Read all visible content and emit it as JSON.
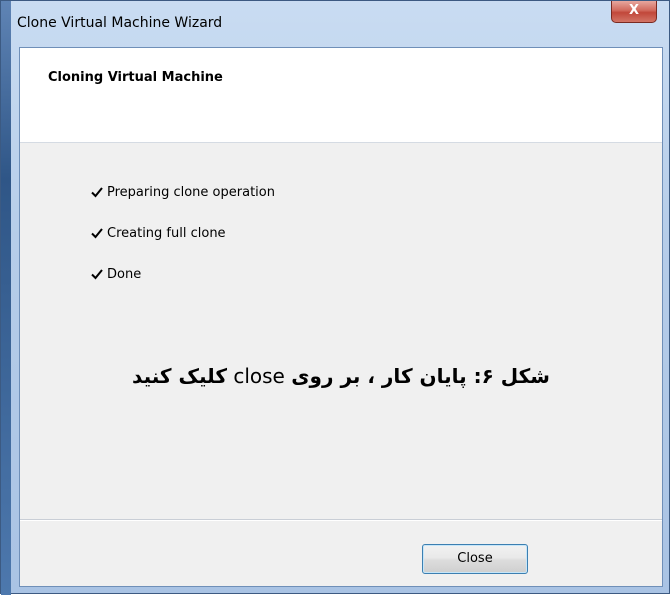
{
  "window": {
    "title": "Clone Virtual Machine Wizard",
    "close_glyph": "X",
    "close_icon": "close-icon"
  },
  "header": {
    "title": "Cloning Virtual Machine"
  },
  "steps": [
    {
      "icon": "check-icon",
      "label": "Preparing clone operation"
    },
    {
      "icon": "check-icon",
      "label": "Creating full clone"
    },
    {
      "icon": "check-icon",
      "label": "Done"
    }
  ],
  "caption": {
    "part1": "شکل ۶: پایان کار ، بر روی",
    "part2": "close",
    "part3": "کلیک کنید"
  },
  "footer": {
    "close_label": "Close"
  },
  "colors": {
    "titlebar": "#b6cde9",
    "client_bg": "#f0f0f0",
    "header_bg": "#ffffff",
    "close_button": "#c1473a",
    "focus_border": "#3c7fb1"
  }
}
